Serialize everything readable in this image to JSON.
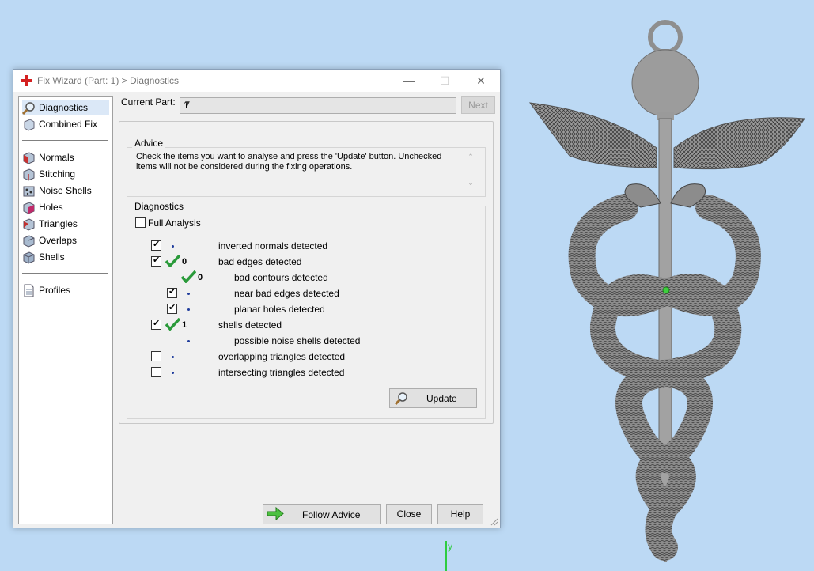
{
  "window": {
    "title": "Fix Wizard (Part: 1) > Diagnostics",
    "minimize": "—",
    "maximize": "☐",
    "close": "✕"
  },
  "sidebar": {
    "items": [
      {
        "label": "Diagnostics",
        "icon": "magnifier-icon",
        "selected": true
      },
      {
        "label": "Combined Fix",
        "icon": "combined-fix-icon"
      },
      {
        "label": "Normals",
        "icon": "normals-icon"
      },
      {
        "label": "Stitching",
        "icon": "stitching-icon"
      },
      {
        "label": "Noise Shells",
        "icon": "noise-shells-icon"
      },
      {
        "label": "Holes",
        "icon": "holes-icon"
      },
      {
        "label": "Triangles",
        "icon": "triangles-icon"
      },
      {
        "label": "Overlaps",
        "icon": "overlaps-icon"
      },
      {
        "label": "Shells",
        "icon": "shells-icon"
      },
      {
        "label": "Profiles",
        "icon": "profiles-icon"
      }
    ]
  },
  "header": {
    "current_part_label": "Current Part:",
    "current_part_value": "1",
    "next_label": "Next"
  },
  "advice": {
    "title": "Advice",
    "line1": "Check the items you want to analyse and press the 'Update' button. Unchecked",
    "line2": "items will not be considered during the fixing operations."
  },
  "diagnostics": {
    "title": "Diagnostics",
    "full_analysis": "Full Analysis",
    "rows": [
      {
        "label": "inverted normals detected",
        "checked": true,
        "value": ""
      },
      {
        "label": "bad edges detected",
        "checked": true,
        "value": "0",
        "ok": true
      },
      {
        "label": "bad contours detected",
        "checked": null,
        "value": "0",
        "ok": true
      },
      {
        "label": "near bad edges detected",
        "checked": true,
        "value": ""
      },
      {
        "label": "planar holes detected",
        "checked": true,
        "value": ""
      },
      {
        "label": "shells detected",
        "checked": true,
        "value": "1",
        "ok": true
      },
      {
        "label": "possible noise shells detected",
        "checked": null,
        "value": ""
      },
      {
        "label": "overlapping triangles detected",
        "checked": false,
        "value": ""
      },
      {
        "label": "intersecting triangles detected",
        "checked": false,
        "value": ""
      }
    ],
    "update_label": "Update"
  },
  "footer": {
    "follow_advice": "Follow Advice",
    "close": "Close",
    "help": "Help"
  },
  "viewport": {
    "axis_label": "y",
    "axis_color": "#2ecc40",
    "background": "#bcd9f4"
  }
}
